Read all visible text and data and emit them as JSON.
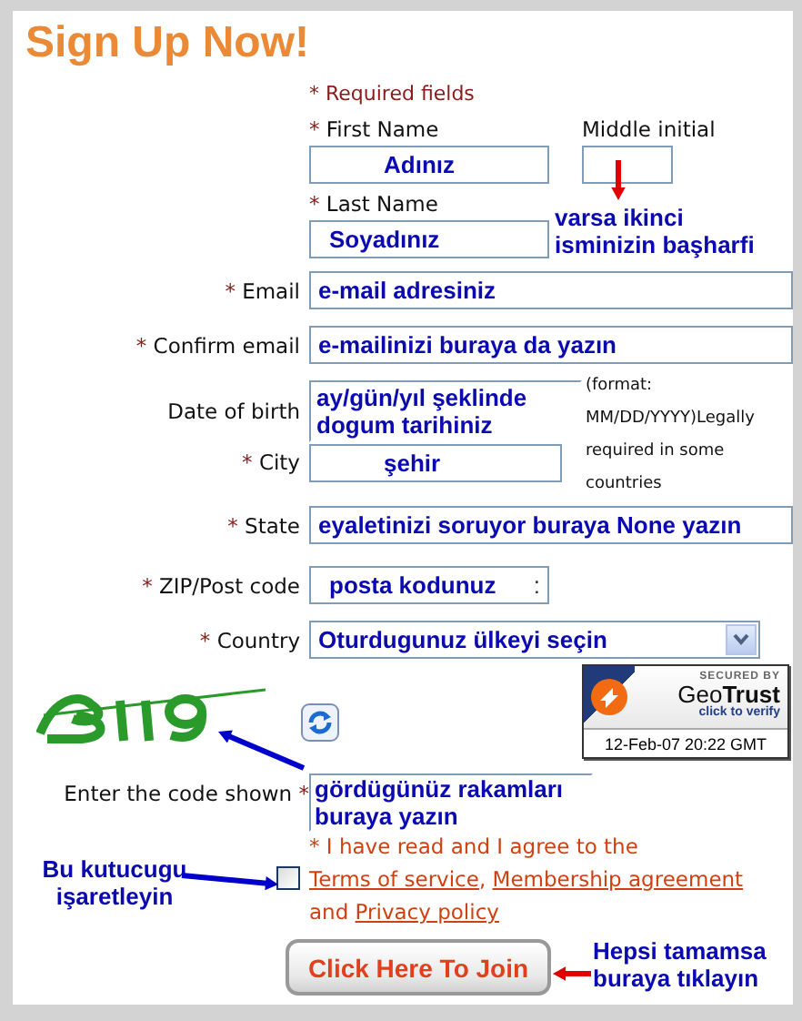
{
  "title": "Sign Up Now!",
  "required_note": "* Required fields",
  "required_mark": "*",
  "first_name": {
    "label": "First Name",
    "required": true,
    "value": "Adınız"
  },
  "middle_initial": {
    "label": "Middle initial",
    "required": false
  },
  "last_name": {
    "label": "Last Name",
    "required": true,
    "value": "Soyadınız"
  },
  "rows": [
    {
      "kind": "text",
      "label": "Email",
      "required": true,
      "value": "e-mail adresiniz"
    },
    {
      "kind": "text",
      "label": "Confirm email",
      "required": true,
      "value": "e-mailinizi buraya da yazın"
    }
  ],
  "date_of_birth": {
    "label": "Date of birth",
    "required": false,
    "value": "ay/gün/yıl şeklinde dogum tarihiniz",
    "note": "(format: MM/DD/YYYY)Legally required in some countries"
  },
  "city": {
    "label": "City",
    "required": true,
    "value": "şehir"
  },
  "rows2": [
    {
      "kind": "text",
      "label": "State",
      "required": true,
      "value": "eyaletinizi soruyor buraya None yazın"
    },
    {
      "kind": "text",
      "label": "ZIP/Post code",
      "required": true,
      "value": "posta kodunuz",
      "suffix": ":"
    },
    {
      "kind": "select",
      "label": "Country",
      "required": true,
      "value": "Oturdugunuz ülkeyi seçin"
    }
  ],
  "security_badge": {
    "heading": "SECURED BY",
    "brand_light": "Geo",
    "brand_bold": "Trust",
    "action": "click to verify",
    "timestamp": "12-Feb-07 20:22 GMT"
  },
  "code_field": {
    "label": "Enter the code shown",
    "required": true,
    "value": "gördügünüz rakamları buraya yazın"
  },
  "agreement": {
    "checked": false,
    "lead": "* I have read and I agree to the ",
    "links": [
      "Terms of service",
      "Membership agreement",
      "Privacy policy"
    ],
    "separators": [
      ", ",
      " and "
    ]
  },
  "join_button": "Click Here To Join",
  "annotations": [
    {
      "kind": "middle",
      "text": "varsa ikinci isminizin başharfi",
      "color": "#e00000"
    },
    {
      "kind": "captcha",
      "color": "#0000cc"
    },
    {
      "kind": "checkbox",
      "text": "Bu kutucugu işaretleyin",
      "color": "#0000cc"
    },
    {
      "kind": "button",
      "text": "Hepsi tamamsa buraya tıklayın",
      "color": "#e00000"
    }
  ]
}
